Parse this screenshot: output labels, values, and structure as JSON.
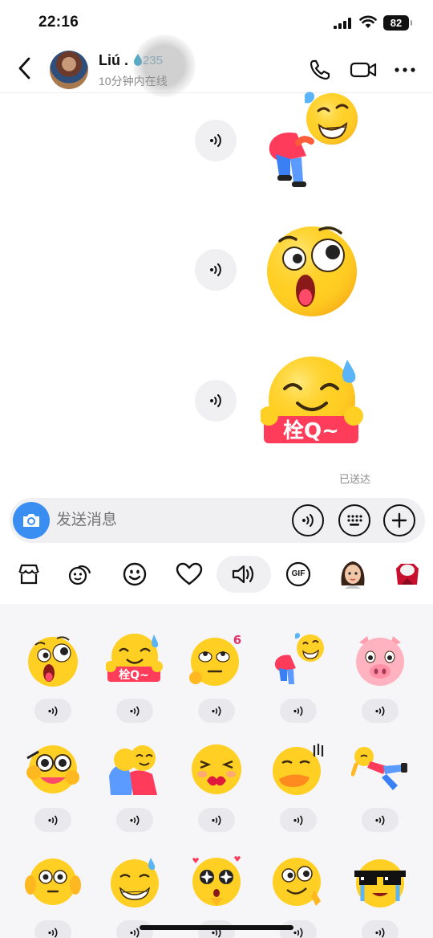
{
  "status_bar": {
    "time": "22:16",
    "battery": "82"
  },
  "header": {
    "name": "Liú .",
    "streak": "235",
    "presence": "10分钟内在线"
  },
  "messages": [
    {
      "sticker": "bowing-emoji-sticker",
      "sound": true
    },
    {
      "sticker": "shocked-emoji-sticker",
      "sound": true
    },
    {
      "sticker": "thanks-emoji-sticker",
      "sound": true,
      "caption": "栓Q~"
    }
  ],
  "delivery_status": "已送达",
  "composer": {
    "placeholder": "发送消息"
  },
  "tabs": [
    {
      "icon": "store-icon"
    },
    {
      "icon": "sticker-pack-icon"
    },
    {
      "icon": "smiley-icon"
    },
    {
      "icon": "heart-icon"
    },
    {
      "icon": "speaker-icon",
      "active": true
    },
    {
      "icon": "gif-icon",
      "label": "GIF"
    },
    {
      "icon": "avatar-sticker-icon"
    },
    {
      "icon": "red-pack-icon"
    }
  ],
  "grid": [
    {
      "name": "shocked",
      "caption": ""
    },
    {
      "name": "thanks",
      "caption": "栓Q~"
    },
    {
      "name": "eye-roll",
      "caption": "6"
    },
    {
      "name": "bowing",
      "caption": ""
    },
    {
      "name": "pig",
      "caption": ""
    },
    {
      "name": "fangirl",
      "caption": ""
    },
    {
      "name": "hug",
      "caption": ""
    },
    {
      "name": "kiss",
      "caption": ""
    },
    {
      "name": "duck-lips",
      "caption": ""
    },
    {
      "name": "lying-down",
      "caption": ""
    },
    {
      "name": "covering-ears",
      "caption": ""
    },
    {
      "name": "grimace-sweat",
      "caption": ""
    },
    {
      "name": "starstruck",
      "caption": ""
    },
    {
      "name": "smug",
      "caption": ""
    },
    {
      "name": "cool-shades",
      "caption": ""
    }
  ]
}
